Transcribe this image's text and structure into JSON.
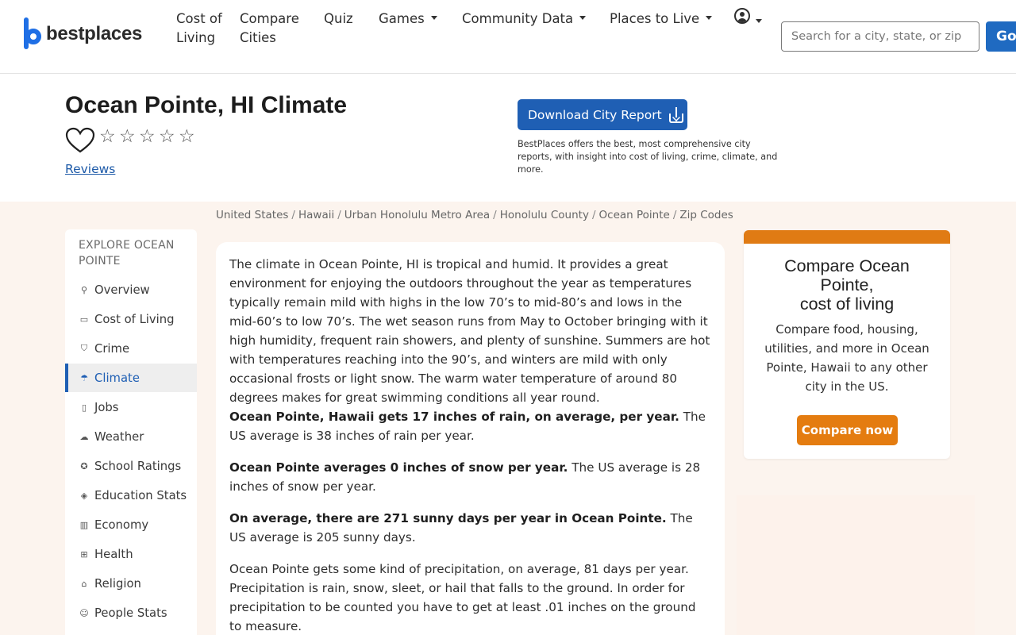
{
  "nav": {
    "logo_text": "bestplaces",
    "items": [
      {
        "label": "Cost of Living",
        "dropdown": false
      },
      {
        "label": "Compare Cities",
        "dropdown": false
      },
      {
        "label": "Quiz",
        "dropdown": false
      },
      {
        "label": "Games",
        "dropdown": true
      },
      {
        "label": "Community Data",
        "dropdown": true
      },
      {
        "label": "Places to Live",
        "dropdown": true
      }
    ],
    "search_placeholder": "Search for a city, state, or zip",
    "go_label": "Go"
  },
  "header": {
    "title": "Ocean Pointe, HI Climate",
    "rating_stars": 0,
    "reviews_label": "Reviews",
    "download_label": "Download City Report",
    "download_blurb": "BestPlaces offers the best, most comprehensive city reports, with insight into cost of living, crime, climate, and more."
  },
  "breadcrumb": [
    "United States",
    "Hawaii",
    "Urban Honolulu Metro Area",
    "Honolulu County",
    "Ocean Pointe",
    "Zip Codes"
  ],
  "sidebar": {
    "heading": "EXPLORE OCEAN POINTE",
    "items": [
      {
        "label": "Overview",
        "icon": "map-pin-icon",
        "active": false
      },
      {
        "label": "Cost of Living",
        "icon": "wallet-icon",
        "active": false
      },
      {
        "label": "Crime",
        "icon": "shield-icon",
        "active": false
      },
      {
        "label": "Climate",
        "icon": "umbrella-icon",
        "active": true
      },
      {
        "label": "Jobs",
        "icon": "clipboard-icon",
        "active": false
      },
      {
        "label": "Weather",
        "icon": "cloud-rain-icon",
        "active": false
      },
      {
        "label": "School Ratings",
        "icon": "badge-icon",
        "active": false
      },
      {
        "label": "Education Stats",
        "icon": "graduation-cap-icon",
        "active": false
      },
      {
        "label": "Economy",
        "icon": "bank-icon",
        "active": false
      },
      {
        "label": "Health",
        "icon": "first-aid-icon",
        "active": false
      },
      {
        "label": "Religion",
        "icon": "church-icon",
        "active": false
      },
      {
        "label": "People Stats",
        "icon": "people-icon",
        "active": false
      }
    ]
  },
  "content": {
    "intro": "The climate in Ocean Pointe, HI is tropical and humid. It provides a great environment for enjoying the outdoors throughout the year as temperatures typically remain mild with highs in the low 70’s to mid-80’s and lows in the mid-60’s to low 70’s. The wet season runs from May to October bringing with it high humidity, frequent rain showers, and plenty of sunshine. Summers are hot with temperatures reaching into the 90’s, and winters are mild with only occasional frosts or light snow. The warm water temperature of around 80 degrees makes for great swimming conditions all year round.",
    "rain_bold": "Ocean Pointe, Hawaii gets 17 inches of rain, on average, per year.",
    "rain_rest": " The US average is 38 inches of rain per year.",
    "snow_bold": "Ocean Pointe averages 0 inches of snow per year.",
    "snow_rest": " The US average is 28 inches of snow per year.",
    "sun_bold": "On average, there are 271 sunny days per year in Ocean Pointe.",
    "sun_rest": " The US average is 205 sunny days.",
    "precip": "Ocean Pointe gets some kind of precipitation, on average, 81 days per year. Precipitation is rain, snow, sleet, or hail that falls to the ground. In order for precipitation to be counted you have to get at least .01 inches on the ground to measure."
  },
  "compare": {
    "title_line1": "Compare Ocean Pointe,",
    "title_line2": "cost of living",
    "desc": "Compare food, housing, utilities, and more in Ocean Pointe, Hawaii to any other city in the US.",
    "button": "Compare now"
  },
  "colors": {
    "brand_blue": "#1f6fe5",
    "button_blue": "#1f5fb4",
    "accent_orange": "#e47c10",
    "page_bg": "#fcf4ee"
  }
}
